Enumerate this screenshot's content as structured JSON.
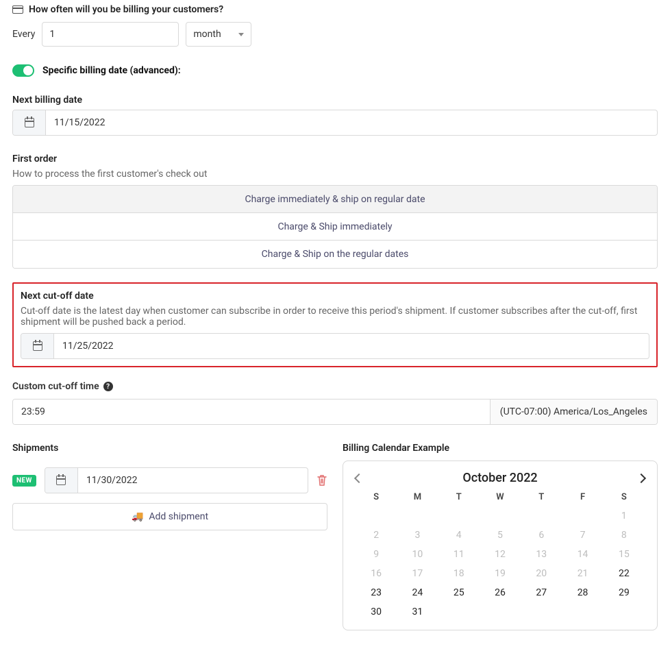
{
  "billing_frequency": {
    "header": "How often will you be billing your customers?",
    "every_label": "Every",
    "interval_value": "1",
    "unit_value": "month"
  },
  "specific_date": {
    "toggle_label": "Specific billing date (advanced):"
  },
  "next_billing": {
    "label": "Next billing date",
    "value": "11/15/2022"
  },
  "first_order": {
    "label": "First order",
    "subtext": "How to process the first customer's check out",
    "options": [
      "Charge immediately & ship on regular date",
      "Charge & Ship immediately",
      "Charge & Ship on the regular dates"
    ],
    "selected_index": 0
  },
  "cutoff": {
    "label": "Next cut-off date",
    "subtext": "Cut-off date is the latest day when customer can subscribe in order to receive this period's shipment. If customer subscribes after the cut-off, first shipment will be pushed back a period.",
    "value": "11/25/2022"
  },
  "cutoff_time": {
    "label": "Custom cut-off time",
    "value": "23:59",
    "timezone": "(UTC-07:00) America/Los_Angeles"
  },
  "shipments": {
    "label": "Shipments",
    "new_badge": "NEW",
    "rows": [
      {
        "date": "11/30/2022"
      }
    ],
    "add_label": "Add shipment"
  },
  "calendar": {
    "header": "Billing Calendar Example",
    "month_label": "October 2022",
    "dow": [
      "S",
      "M",
      "T",
      "W",
      "T",
      "F",
      "S"
    ],
    "leading_blanks": 6,
    "days": [
      {
        "n": 1,
        "muted": true
      },
      {
        "n": 2,
        "muted": true
      },
      {
        "n": 3,
        "muted": true
      },
      {
        "n": 4,
        "muted": true
      },
      {
        "n": 5,
        "muted": true
      },
      {
        "n": 6,
        "muted": true
      },
      {
        "n": 7,
        "muted": true
      },
      {
        "n": 8,
        "muted": true
      },
      {
        "n": 9,
        "muted": true
      },
      {
        "n": 10,
        "muted": true
      },
      {
        "n": 11,
        "muted": true
      },
      {
        "n": 12,
        "muted": true
      },
      {
        "n": 13,
        "muted": true
      },
      {
        "n": 14,
        "muted": true
      },
      {
        "n": 15,
        "muted": true
      },
      {
        "n": 16,
        "muted": true
      },
      {
        "n": 17,
        "muted": true
      },
      {
        "n": 18,
        "muted": true
      },
      {
        "n": 19,
        "muted": true
      },
      {
        "n": 20,
        "muted": true
      },
      {
        "n": 21,
        "muted": true
      },
      {
        "n": 22,
        "muted": false
      },
      {
        "n": 23,
        "muted": false
      },
      {
        "n": 24,
        "muted": false
      },
      {
        "n": 25,
        "muted": false
      },
      {
        "n": 26,
        "muted": false
      },
      {
        "n": 27,
        "muted": false
      },
      {
        "n": 28,
        "muted": false
      },
      {
        "n": 29,
        "muted": false
      },
      {
        "n": 30,
        "muted": false
      },
      {
        "n": 31,
        "muted": false
      }
    ]
  }
}
